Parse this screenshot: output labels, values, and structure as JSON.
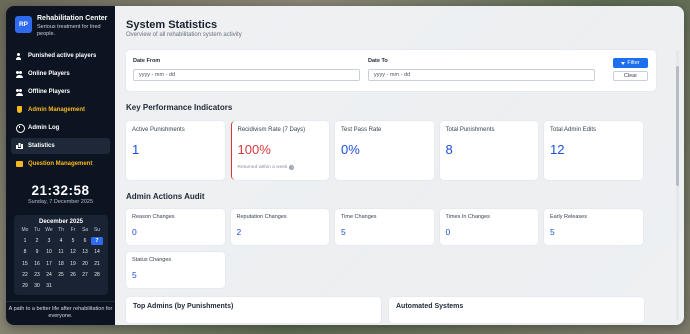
{
  "brand": {
    "logo": "RP",
    "name": "Rehabilitation Center",
    "tagline": "Serious treatment for tired people."
  },
  "nav": [
    {
      "label": "Punished active players",
      "icon": "user-icon",
      "style": "normal"
    },
    {
      "label": "Online Players",
      "icon": "users-icon",
      "style": "normal"
    },
    {
      "label": "Offline Players",
      "icon": "users-icon",
      "style": "normal"
    },
    {
      "label": "Admin Management",
      "icon": "admin-icon",
      "style": "gold"
    },
    {
      "label": "Admin Log",
      "icon": "log-icon",
      "style": "normal"
    },
    {
      "label": "Statistics",
      "icon": "chart-icon",
      "style": "active"
    },
    {
      "label": "Question Management",
      "icon": "folder-icon",
      "style": "gold"
    }
  ],
  "clock": {
    "time": "21:32:58",
    "date": "Sunday, 7 December 2025"
  },
  "calendar": {
    "title": "December 2025",
    "weekdays": [
      "Mo",
      "Tu",
      "We",
      "Th",
      "Fr",
      "Sa",
      "Su"
    ],
    "days": [
      "1",
      "2",
      "3",
      "4",
      "5",
      "6",
      "7",
      "8",
      "9",
      "10",
      "11",
      "12",
      "13",
      "14",
      "15",
      "16",
      "17",
      "18",
      "19",
      "20",
      "21",
      "22",
      "23",
      "24",
      "25",
      "26",
      "27",
      "28",
      "29",
      "30",
      "31"
    ],
    "today": "7"
  },
  "footer": "A path to a better life after rehabilitation for everyone.",
  "page": {
    "title": "System Statistics",
    "subtitle": "Overview of all rehabilitation system activity"
  },
  "filters": {
    "from_label": "Date From",
    "to_label": "Date To",
    "from_placeholder": "yyyy - mm - dd",
    "to_placeholder": "yyyy - mm - dd",
    "filter_button": "Filter",
    "clear_button": "Clear"
  },
  "kpi": {
    "title": "Key Performance Indicators",
    "items": [
      {
        "label": "Active Punishments",
        "value": "1"
      },
      {
        "label": "Recidivism Rate (7 Days)",
        "value": "100%",
        "note": "Returned within a week"
      },
      {
        "label": "Test Pass Rate",
        "value": "0%"
      },
      {
        "label": "Total Punishments",
        "value": "8"
      },
      {
        "label": "Total Admin Edits",
        "value": "12"
      }
    ]
  },
  "audit": {
    "title": "Admin Actions Audit",
    "items": [
      {
        "label": "Reason Changes",
        "value": "0"
      },
      {
        "label": "Reputation Changes",
        "value": "2"
      },
      {
        "label": "Time Changes",
        "value": "5"
      },
      {
        "label": "Times In Changes",
        "value": "0"
      },
      {
        "label": "Early Releases",
        "value": "5"
      },
      {
        "label": "Status Changes",
        "value": "5"
      }
    ]
  },
  "bottom": {
    "top_admins": "Top Admins (by Punishments)",
    "automated": "Automated Systems"
  },
  "colors": {
    "sidebar": "#0d1421",
    "accent": "#1d6fef",
    "gold": "#f5b820",
    "alert": "#d33a3a",
    "value_blue": "#1d4ed8"
  }
}
